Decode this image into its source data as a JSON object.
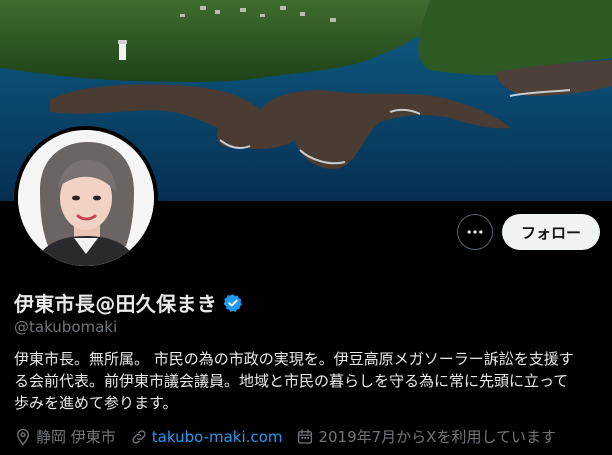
{
  "profile": {
    "display_name": "伊東市長@田久保まき",
    "handle": "@takubomaki",
    "bio_lines": [
      "伊東市長。無所属。 市民の為の市政の実現を。伊豆高原メガソーラー訴訟を支援す",
      "る会前代表。前伊東市議会議員。地域と市民の暮らしを守る為に常に先頭に立って",
      "歩みを進めて参ります。"
    ],
    "location": "静岡 伊東市",
    "website": "takubo-maki.com",
    "joined": "2019年7月からXを利用しています"
  },
  "actions": {
    "follow_label": "フォロー",
    "more_icon": "more-horizontal-icon"
  },
  "icons": {
    "verified": "verified-badge-icon",
    "location": "location-pin-icon",
    "link": "link-icon",
    "calendar": "calendar-icon"
  },
  "colors": {
    "background": "#000000",
    "text_primary": "#e7e9ea",
    "text_secondary": "#71767b",
    "accent": "#1d9bf0",
    "follow_button": "#eff3f4"
  }
}
